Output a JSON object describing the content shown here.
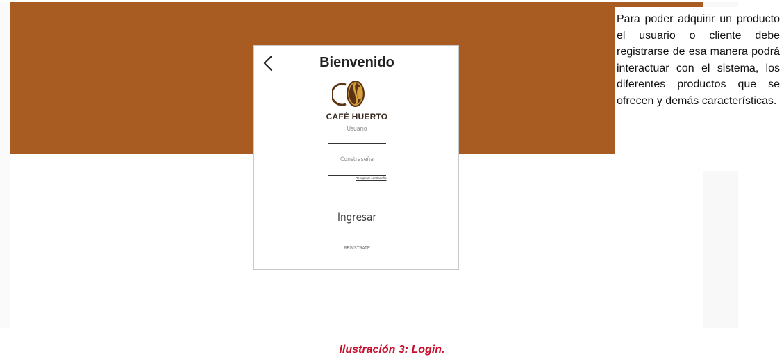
{
  "screen": {
    "title": "Bienvenido",
    "brand_name": "CAFÉ HUERTO",
    "username_label": "Usuario",
    "password_label": "Constraseña",
    "forgot_password_link": "Recuperar contraseña",
    "login_button": "Ingresar",
    "register_link": "REGISTRATE",
    "icons": {
      "back": "chevron-left-icon",
      "logo": "coffee-bean-logo"
    },
    "colors": {
      "header_band": "#a85c21",
      "logo_brown": "#5a3214",
      "logo_gold": "#d6a03c"
    }
  },
  "description": "Para poder adquirir un producto el usuario o cliente debe registrarse de esa manera podrá interactuar con el sistema, los diferentes productos que se ofrecen y demás características.",
  "caption": {
    "text": "Ilustración 3: Login.",
    "color": "#c8102e"
  }
}
